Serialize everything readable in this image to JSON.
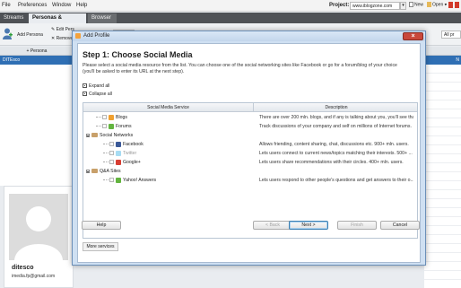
{
  "menubar": {
    "items": [
      "File",
      "Preferences",
      "Window",
      "Help"
    ],
    "project_label": "Project:",
    "project_value": "www.iblogzone.com",
    "new_label": "New",
    "open_label": "Open"
  },
  "tabs": [
    "Streams",
    "Personas & Profiles",
    "Browser"
  ],
  "toolbar": {
    "add_person": "Add Persona",
    "edit_persona": "Edit Pers",
    "remove_persona": "Remove",
    "all_filter": "All pr"
  },
  "left_panel": {
    "header": "+ Persona",
    "selected_row": "DITEsco"
  },
  "right_panel": {
    "selected_row": "N"
  },
  "profile": {
    "name": "ditesco",
    "email": "imedia.fp@gmail.com"
  },
  "dialog": {
    "title": "Add Profile",
    "step_title": "Step 1: Choose Social Media",
    "intro_line1": "Please select a social media resource from the list. You can choose one of the social networking sites like Facebook or go for a forum/blog of your choice",
    "intro_line2": "(you'll be asked to enter its URL at the next step).",
    "expand_all": "Expand all",
    "collapse_all": "Collapse all",
    "columns": [
      "Social Media Service",
      "Description"
    ],
    "rows": [
      {
        "label": "Blogs",
        "description": "There are over 200 mln. blogs, and if any is talking about you, you'll see that.",
        "icon": "blog-icon",
        "color": "#f0a030"
      },
      {
        "label": "Forums",
        "description": "Track discussions of your company and self on millions of Internet forums.",
        "icon": "forum-icon",
        "color": "#63b43f"
      },
      {
        "label": "Social Networks",
        "description": "",
        "icon": "folder-icon",
        "color": "#c8a06a"
      },
      {
        "label": "Facebook",
        "description": "Allows friending, content sharing, chat, discussions etc. 900+ mln. users.",
        "icon": "facebook-icon",
        "color": "#3b5998"
      },
      {
        "label": "Twitter",
        "description": "Lets users connect to current news/topics matching their interests. 500+ ...",
        "icon": "twitter-icon",
        "color": "#4fb9e8"
      },
      {
        "label": "Google+",
        "description": "Lets users share recommendations with their circles. 400+ mln. users.",
        "icon": "google-plus-icon",
        "color": "#d73d32"
      },
      {
        "label": "Q&A Sites",
        "description": "",
        "icon": "folder-icon",
        "color": "#c8a06a"
      },
      {
        "label": "Yahoo! Answers",
        "description": "Lets users respond to other people's questions and get answers to their o...",
        "icon": "yahoo-answers-icon",
        "color": "#63b43f"
      }
    ],
    "more_services": "More services",
    "buttons": {
      "help": "Help",
      "back": "< Back",
      "next": "Next >",
      "finish": "Finish",
      "cancel": "Cancel"
    }
  }
}
